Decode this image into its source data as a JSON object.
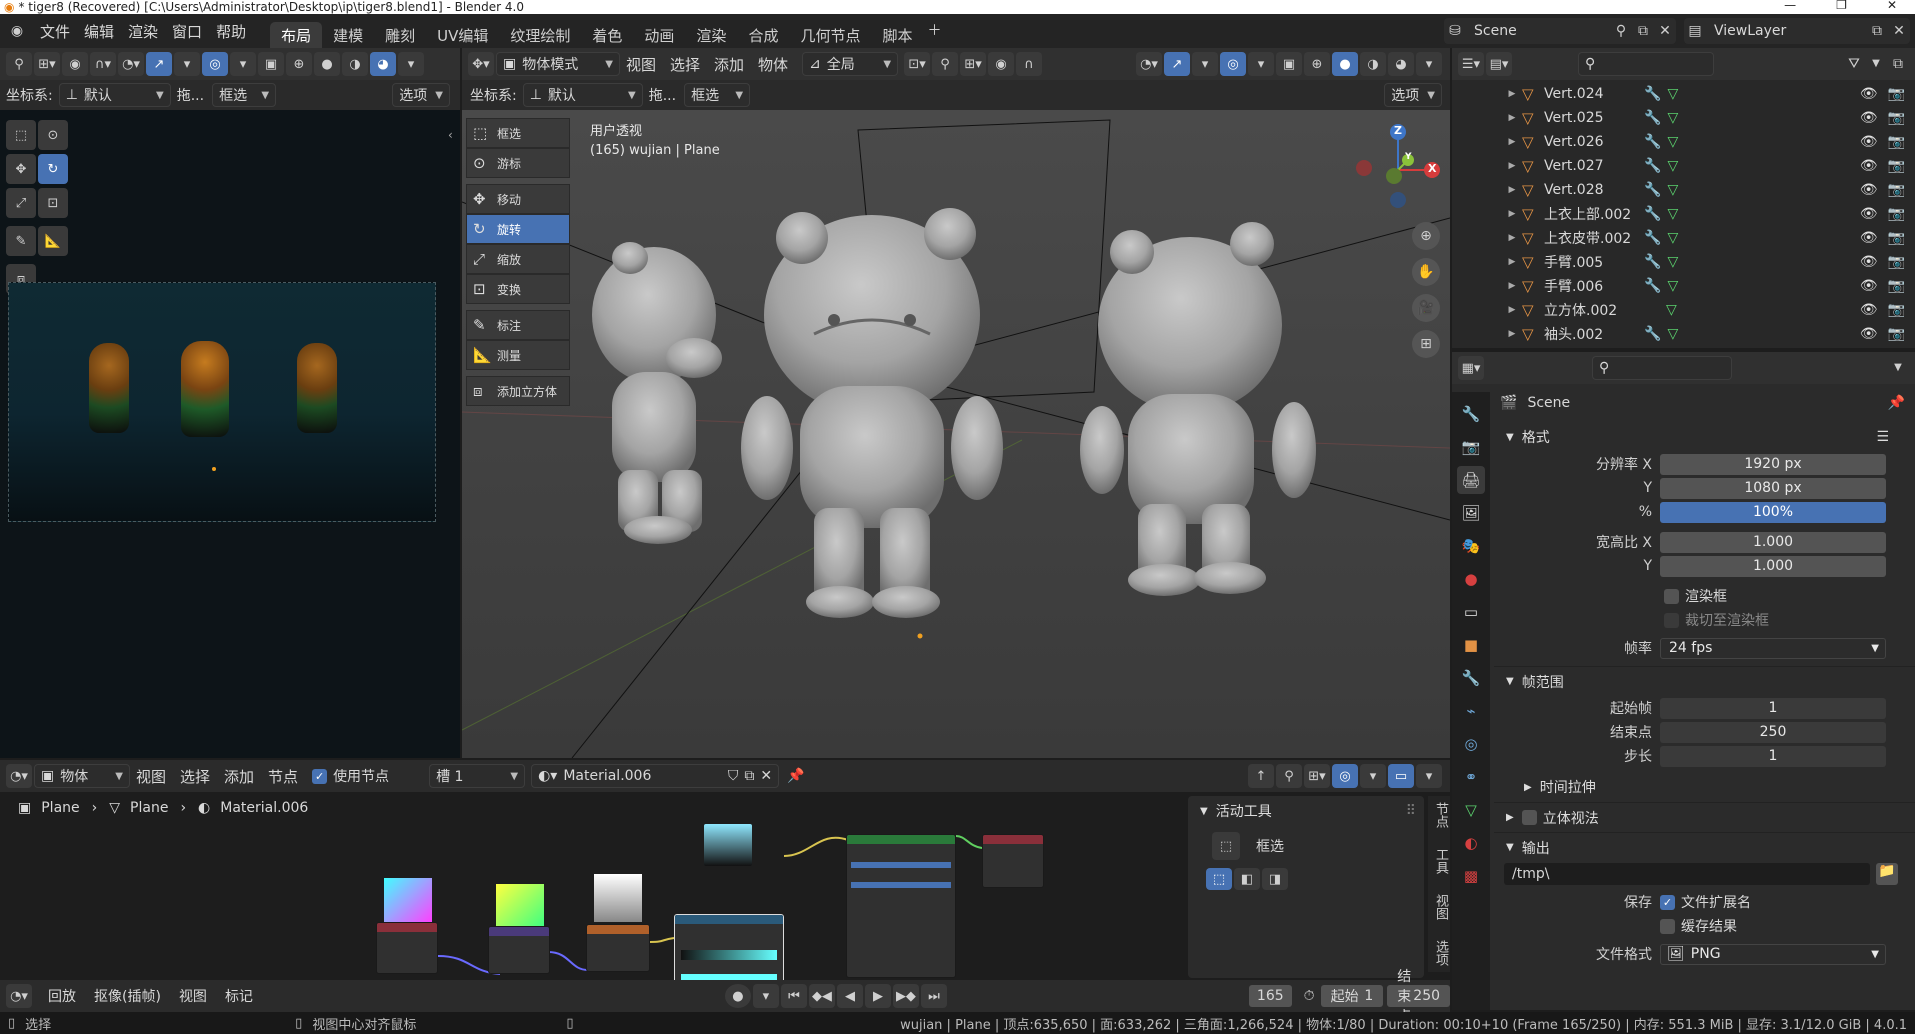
{
  "window": {
    "title": "* tiger8 (Recovered) [C:\\Users\\Administrator\\Desktop\\ip\\tiger8.blend1] - Blender 4.0"
  },
  "topmenu": [
    "文件",
    "编辑",
    "渲染",
    "窗口",
    "帮助"
  ],
  "workspaces": [
    "布局",
    "建模",
    "雕刻",
    "UV编辑",
    "纹理绘制",
    "着色",
    "动画",
    "渲染",
    "合成",
    "几何节点",
    "脚本"
  ],
  "active_workspace": "布局",
  "scene_name": "Scene",
  "viewlayer_name": "ViewLayer",
  "left_view": {
    "coord_label": "坐标系:",
    "coord_value": "默认",
    "drag_label": "拖...",
    "select_mode": "框选",
    "options": "选项"
  },
  "viewport": {
    "mode": "物体模式",
    "menus": [
      "视图",
      "选择",
      "添加",
      "物体"
    ],
    "transform": "全局",
    "coord_label": "坐标系:",
    "coord_value": "默认",
    "drag_label": "拖...",
    "select_mode": "框选",
    "options": "选项",
    "view_name": "用户透视",
    "view_info": "(165) wujian | Plane",
    "tools": [
      {
        "label": "框选",
        "icon": "select-box-icon",
        "active": false
      },
      {
        "label": "游标",
        "icon": "cursor-icon",
        "active": false
      },
      {
        "label": "移动",
        "icon": "move-icon",
        "active": false
      },
      {
        "label": "旋转",
        "icon": "rotate-icon",
        "active": true
      },
      {
        "label": "缩放",
        "icon": "scale-icon",
        "active": false
      },
      {
        "label": "变换",
        "icon": "transform-icon",
        "active": false
      },
      {
        "label": "标注",
        "icon": "annotate-icon",
        "active": false
      },
      {
        "label": "测量",
        "icon": "measure-icon",
        "active": false
      },
      {
        "label": "添加立方体",
        "icon": "add-cube-icon",
        "active": false
      }
    ],
    "gizmo": {
      "z": "Z",
      "y": "Y",
      "x": "X"
    }
  },
  "outliner": {
    "items": [
      {
        "name": "Vert.024",
        "mod": true
      },
      {
        "name": "Vert.025",
        "mod": true
      },
      {
        "name": "Vert.026",
        "mod": true
      },
      {
        "name": "Vert.027",
        "mod": true
      },
      {
        "name": "Vert.028",
        "mod": true
      },
      {
        "name": "上衣上部.002",
        "mod": true
      },
      {
        "name": "上衣皮带.002",
        "mod": true
      },
      {
        "name": "手臂.005",
        "mod": true
      },
      {
        "name": "手臂.006",
        "mod": true
      },
      {
        "name": "立方体.002",
        "mod": false
      },
      {
        "name": "袖头.002",
        "mod": true
      }
    ]
  },
  "properties": {
    "scene": "Scene",
    "format_title": "格式",
    "res_x_label": "分辨率 X",
    "res_x": "1920 px",
    "res_y_label": "Y",
    "res_y": "1080 px",
    "res_pct_label": "%",
    "res_pct": "100%",
    "aspect_x_label": "宽高比 X",
    "aspect_x": "1.000",
    "aspect_y_label": "Y",
    "aspect_y": "1.000",
    "render_region": "渲染框",
    "crop_region": "裁切至渲染框",
    "fps_label": "帧率",
    "fps": "24 fps",
    "frame_range_title": "帧范围",
    "start_label": "起始帧",
    "start": "1",
    "end_label": "结束点",
    "end": "250",
    "step_label": "步长",
    "step": "1",
    "time_stretch": "时间拉伸",
    "stereo": "立体视法",
    "output_title": "输出",
    "output_path": "/tmp\\",
    "save_label": "保存",
    "file_ext": "文件扩展名",
    "cache_result": "缓存结果",
    "file_format_label": "文件格式",
    "file_format": "PNG"
  },
  "node_editor": {
    "editor_type": "物体",
    "menus": [
      "视图",
      "选择",
      "添加",
      "节点"
    ],
    "use_nodes": "使用节点",
    "slot": "槽 1",
    "material": "Material.006",
    "breadcrumb": [
      "Plane",
      "Plane",
      "Material.006"
    ],
    "side_tabs": [
      "节点",
      "工具",
      "视图",
      "选项"
    ],
    "active_tool_title": "活动工具",
    "active_tool": "框选"
  },
  "timeline": {
    "menus": [
      "回放",
      "抠像(插帧)",
      "视图",
      "标记"
    ],
    "frame": "165",
    "start_label": "起始",
    "start": "1",
    "end_label": "结束点",
    "end": "250"
  },
  "statusbar": {
    "select": "选择",
    "center": "视图中心对齐鼠标",
    "info": "wujian | Plane | 顶点:635,650 | 面:633,262 | 三角面:1,266,524 | 物体:1/80 | Duration: 00:10+10 (Frame 165/250) | 内存: 551.3 MiB | 显存: 3.1/12.0 GiB | 4.0.1"
  },
  "colors": {
    "accent": "#4772b3",
    "object": "#e29245",
    "mesh": "#5bd36e",
    "modifier": "#6fa8d8"
  }
}
